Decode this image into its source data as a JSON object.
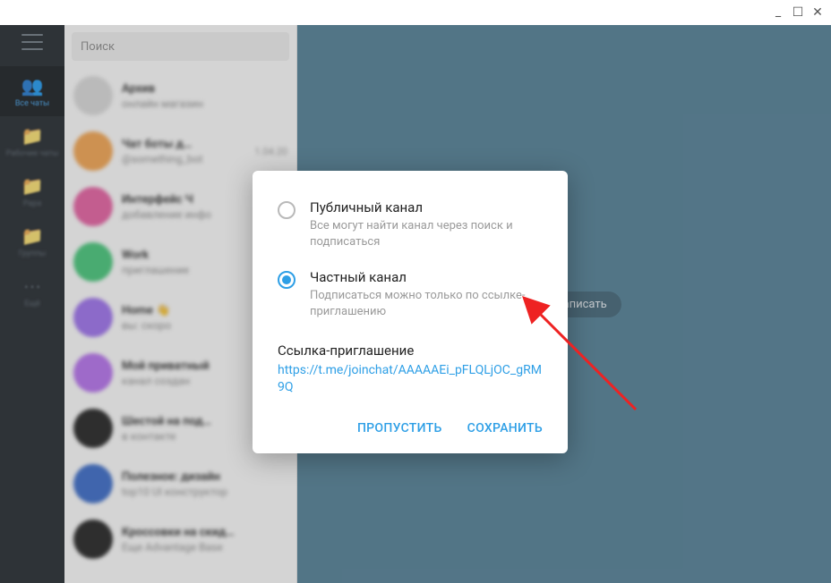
{
  "titlebar": {
    "minimize": "_",
    "maximize": "☐",
    "close": "✕"
  },
  "search": {
    "placeholder": "Поиск"
  },
  "nav": {
    "items": [
      {
        "icon": "👥",
        "label": "Все чаты"
      },
      {
        "icon": "📁",
        "label": "Рабочие чаты"
      },
      {
        "icon": "📁",
        "label": "Papa"
      },
      {
        "icon": "📁",
        "label": "Группы"
      },
      {
        "icon": "⋯",
        "label": "Ещё"
      }
    ]
  },
  "chats": [
    {
      "color": "#dcdcdc",
      "name": "Архив",
      "preview": "онлайн магазин",
      "time": ""
    },
    {
      "color": "#f6a34a",
      "name": "Чат боты д…",
      "preview": "@something_bot",
      "time": "1.04.20"
    },
    {
      "color": "#e85aa0",
      "name": "Интерфейс Ч",
      "preview": "добавление инфо",
      "time": ""
    },
    {
      "color": "#3fc776",
      "name": "Work",
      "preview": "приглашение",
      "time": ""
    },
    {
      "color": "#9b6cf0",
      "name": "Home 👋",
      "preview": "вы: скоро",
      "time": ""
    },
    {
      "color": "#b56cf0",
      "name": "Мой приватный",
      "preview": "канал создан",
      "time": ""
    },
    {
      "color": "#1a1a1a",
      "name": "Шестой на под…",
      "preview": "в контакте",
      "time": ""
    },
    {
      "color": "#3266c9",
      "name": "Полезное: дизайн",
      "preview": "top10 UI конструктор",
      "time": ""
    },
    {
      "color": "#1a1a1a",
      "name": "Кроссовки на скид…",
      "preview": "Еще Advantage Base",
      "time": ""
    }
  ],
  "main": {
    "empty_hint": "ли бы написать"
  },
  "modal": {
    "options": [
      {
        "title": "Публичный канал",
        "desc": "Все могут найти канал через поиск и подписаться"
      },
      {
        "title": "Частный канал",
        "desc": "Подписаться можно только по ссылке-приглашению"
      }
    ],
    "selected_index": 1,
    "invite_header": "Ссылка-приглашение",
    "invite_link": "https://t.me/joinchat/AAAAAEi_pFLQLjOC_gRM9Q",
    "skip": "ПРОПУСТИТЬ",
    "save": "СОХРАНИТЬ"
  }
}
